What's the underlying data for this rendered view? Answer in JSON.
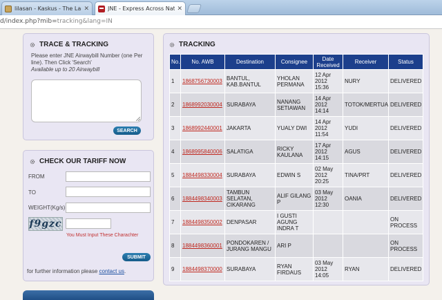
{
  "browser": {
    "tabs": [
      {
        "label": "lilasan - Kaskus - The Larges",
        "active": false
      },
      {
        "label": "JNE - Express Across Nation",
        "active": true
      }
    ],
    "address": {
      "main": "d/index.php?mib=",
      "query": "tracking&lang=IN"
    }
  },
  "trace": {
    "title": "TRACE & TRACKING",
    "instruction": "Please enter JNE Airwaybill Number (one Per line). Then Click 'Search'",
    "availability": "Available up to 20 Airwaybill",
    "search_label": "SEARCH"
  },
  "tariff": {
    "title": "CHECK OUR TARIFF NOW",
    "from_label": "FROM",
    "to_label": "TO",
    "weight_label": "WEIGHT(Kg/s)",
    "captcha_text": "f9gzc",
    "captcha_warning": "You Must Input These Charachter",
    "submit_label": "SUBMIT",
    "further_text": "for further information please ",
    "contact_link": "contact us",
    "further_end": "."
  },
  "tracking": {
    "title": "TRACKING",
    "columns": [
      "No.",
      "No. AWB",
      "Destination",
      "Consignee",
      "Date Received",
      "Receiver",
      "Status"
    ],
    "rows": [
      {
        "no": "1",
        "awb": "1868756730003",
        "destination": "BANTUL, KAB.BANTUL",
        "consignee": "YHOLAN PERMANA",
        "date": "12 Apr 2012 15:36",
        "receiver": "NURY",
        "status": "DELIVERED"
      },
      {
        "no": "2",
        "awb": "1868992030004",
        "destination": "SURABAYA",
        "consignee": "NANANG SETIAWAN",
        "date": "14 Apr 2012 14:14",
        "receiver": "TOTOK/MERTUA",
        "status": "DELIVERED"
      },
      {
        "no": "3",
        "awb": "1868992440001",
        "destination": "JAKARTA",
        "consignee": "YUALY DWI",
        "date": "14 Apr 2012 11:54",
        "receiver": "YUDI",
        "status": "DELIVERED"
      },
      {
        "no": "4",
        "awb": "1868995840006",
        "destination": "SALATIGA",
        "consignee": "RICKY KAULANA",
        "date": "17 Apr 2012 14:15",
        "receiver": "AGUS",
        "status": "DELIVERED"
      },
      {
        "no": "5",
        "awb": "1884498330004",
        "destination": "SURABAYA",
        "consignee": "EDWIN S",
        "date": "02 May 2012 20:25",
        "receiver": "TINA/PRT",
        "status": "DELIVERED"
      },
      {
        "no": "6",
        "awb": "1884498340003",
        "destination": "TAMBUN SELATAN, CIKARANG",
        "consignee": "ALIF GILANG P",
        "date": "03 May 2012 12:30",
        "receiver": "OANIA",
        "status": "DELIVERED"
      },
      {
        "no": "7",
        "awb": "1884498350002",
        "destination": "DENPASAR",
        "consignee": "I GUSTI AGUNG INDRA T",
        "date": "",
        "receiver": "",
        "status": "ON PROCESS"
      },
      {
        "no": "8",
        "awb": "1884498360001",
        "destination": "PONDOKAREN / JURANG MANGU",
        "consignee": "ARI P",
        "date": "",
        "receiver": "",
        "status": "ON PROCESS"
      },
      {
        "no": "9",
        "awb": "1884498370000",
        "destination": "SURABAYA",
        "consignee": "RYAN FIRDAUS",
        "date": "03 May 2012 14:05",
        "receiver": "RYAN",
        "status": "DELIVERED"
      }
    ]
  },
  "colors": {
    "header_blue": "#1c3f8c",
    "awb_red": "#c0271e",
    "button_blue": "#1f6a9c",
    "warning_red": "#c23030"
  }
}
